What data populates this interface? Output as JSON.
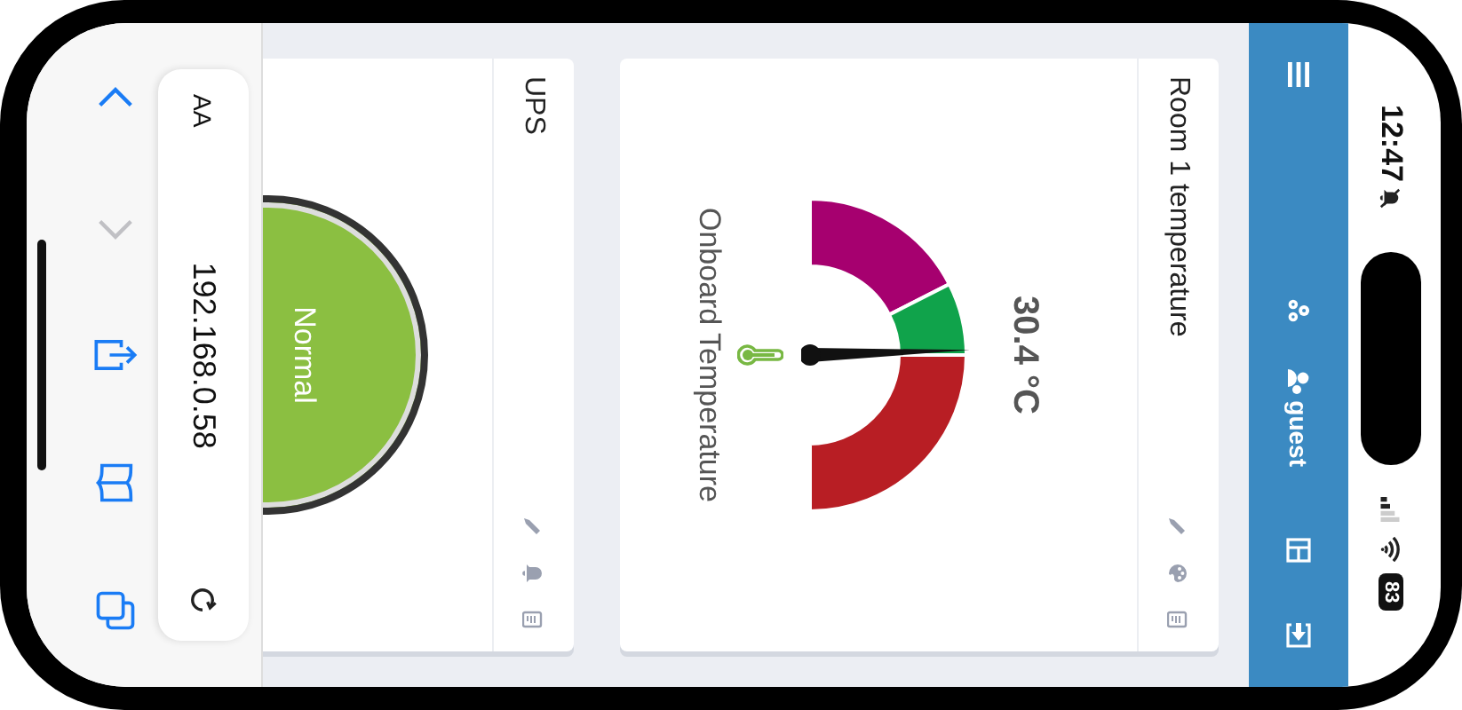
{
  "status_bar": {
    "time": "12:47",
    "battery": "83"
  },
  "nav": {
    "items": [
      {
        "kind": "menu"
      },
      {
        "kind": "settings"
      },
      {
        "kind": "user",
        "label": "guest"
      },
      {
        "kind": "panel"
      },
      {
        "kind": "login"
      }
    ]
  },
  "cards": [
    {
      "kind": "gauge",
      "title": "Room 1 temperature",
      "header_icons": [
        {
          "kind": "edit"
        },
        {
          "kind": "palette"
        },
        {
          "kind": "log"
        }
      ],
      "value": "30.4 °C",
      "caption": "Onboard Temperature",
      "bands": [
        {
          "color": "#a6006f"
        },
        {
          "color": "#10a34b"
        },
        {
          "color": "#b81e24"
        }
      ]
    },
    {
      "kind": "status",
      "title": "UPS",
      "header_icons": [
        {
          "kind": "edit"
        },
        {
          "kind": "alarm"
        },
        {
          "kind": "log"
        }
      ],
      "status": "Normal",
      "color": "#8bbf41"
    }
  ],
  "browser": {
    "text_size": "AA",
    "address": "192.168.0.58",
    "toolbar": [
      {
        "kind": "back",
        "disabled": false
      },
      {
        "kind": "forward",
        "disabled": true
      },
      {
        "kind": "share",
        "disabled": false
      },
      {
        "kind": "bookmarks",
        "disabled": false
      },
      {
        "kind": "tabs",
        "disabled": false
      }
    ]
  }
}
